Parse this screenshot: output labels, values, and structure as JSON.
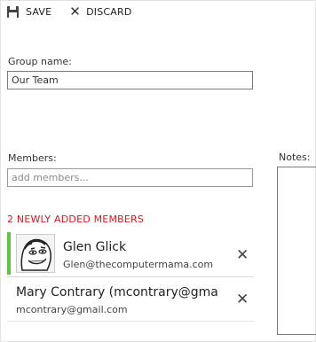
{
  "toolbar": {
    "save_label": "SAVE",
    "discard_label": "DISCARD"
  },
  "group": {
    "label": "Group name:",
    "value": "Our Team"
  },
  "members_field": {
    "label": "Members:",
    "placeholder": "add members..."
  },
  "notes": {
    "label": "Notes:"
  },
  "new_members_header": "2 NEWLY ADDED MEMBERS",
  "members": [
    {
      "name": "Glen Glick",
      "email": "Glen@thecomputermama.com",
      "avatar": "meme-face-avatar"
    },
    {
      "name": "Mary Contrary (mcontrary@gma",
      "email": "mcontrary@gmail.com"
    }
  ],
  "colors": {
    "accent_green": "#5cc73c",
    "header_red": "#d6171f"
  }
}
